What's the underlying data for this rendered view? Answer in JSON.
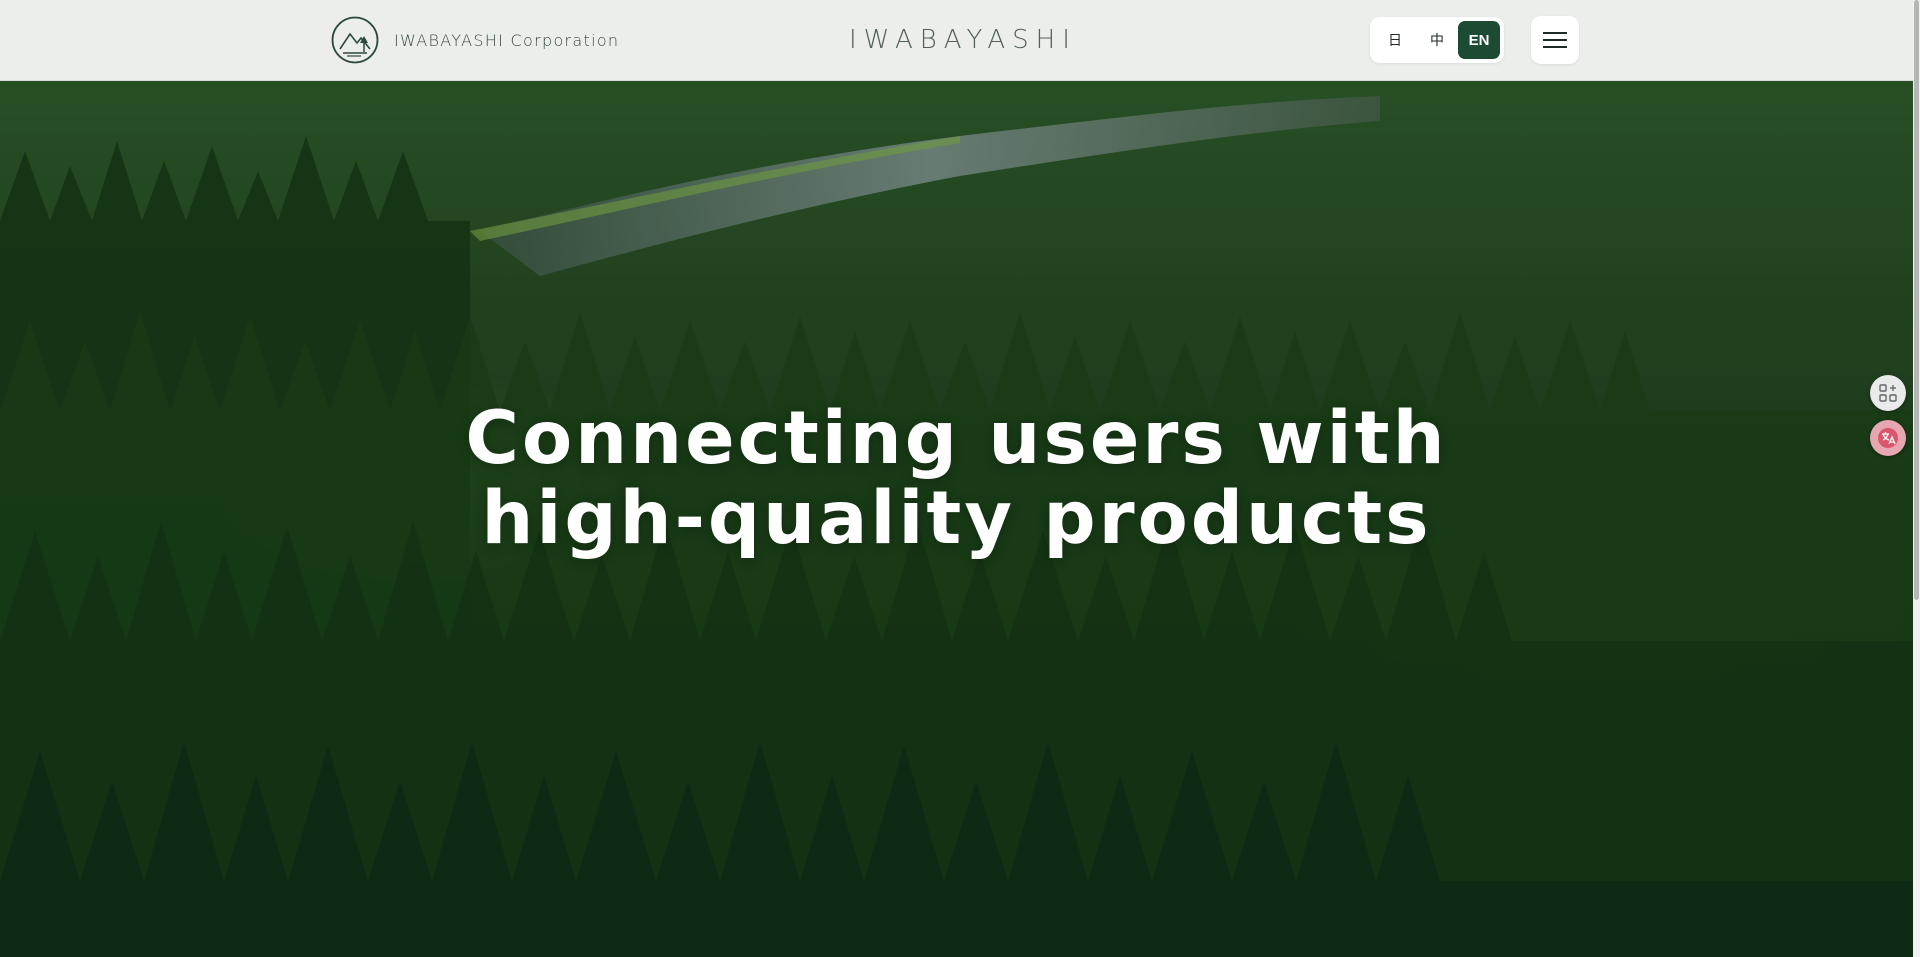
{
  "header": {
    "brand_name": "IWABAYASHI Corporation",
    "wordmark": "IWABAYASHI",
    "languages": [
      {
        "label": "日",
        "active": false
      },
      {
        "label": "中",
        "active": false
      },
      {
        "label": "EN",
        "active": true
      }
    ],
    "menu_icon": "hamburger-menu-icon",
    "logo_icon": "mountain-tree-logo"
  },
  "hero": {
    "headline_line1": "Connecting users with",
    "headline_line2": "high-quality products"
  },
  "side_tools": [
    {
      "icon": "apps-grid-icon"
    },
    {
      "icon": "translate-icon"
    }
  ],
  "colors": {
    "header_bg": "#eceeec",
    "accent": "#1d4a32",
    "text": "#3b4a40"
  }
}
